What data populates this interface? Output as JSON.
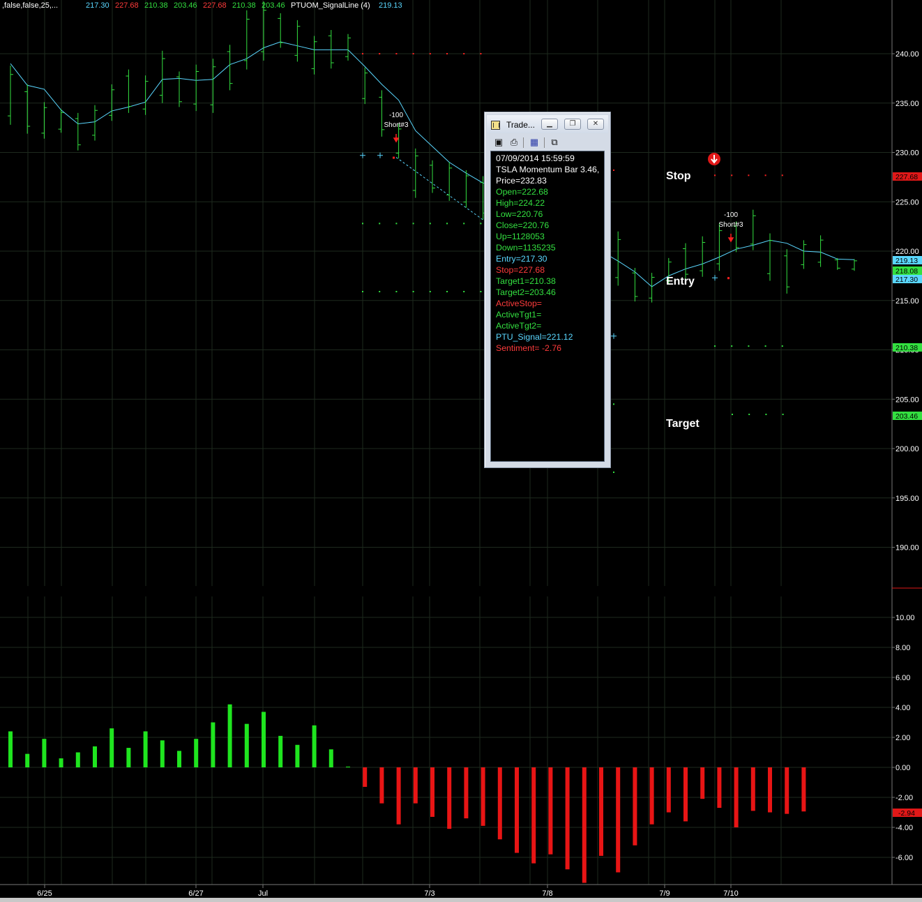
{
  "header": {
    "segments": [
      {
        "text": ",false,false,25,...",
        "color": "#ffffff"
      },
      {
        "text": "217.30",
        "color": "#5ad7ff"
      },
      {
        "text": "227.68",
        "color": "#ff3b3b"
      },
      {
        "text": "210.38",
        "color": "#33e040"
      },
      {
        "text": "203.46",
        "color": "#33e040"
      },
      {
        "text": "227.68",
        "color": "#ff3b3b"
      },
      {
        "text": "210.38",
        "color": "#33e040"
      },
      {
        "text": "203.46",
        "color": "#33e040"
      },
      {
        "text": "PTUOM_SignalLine (4)",
        "color": "#ffffff"
      },
      {
        "text": "219.13",
        "color": "#5ad7ff"
      }
    ]
  },
  "colors": {
    "background": "#000000",
    "bar": "#33e040",
    "signal_line": "#5ad7ff",
    "stop": "#ff2020",
    "target": "#33e040",
    "hist_pos": "#1fe51f",
    "hist_neg": "#e81515",
    "grid": "#1e2a1e",
    "axis_text": "#ffffff"
  },
  "chart_data": [
    {
      "type": "ohlc",
      "name": "price-panel",
      "symbol": "TSLA",
      "ylim": [
        186,
        245
      ],
      "y_ticks": [
        "240.00",
        "235.00",
        "230.00",
        "225.00",
        "220.00",
        "215.00",
        "210.00",
        "205.00",
        "200.00",
        "195.00",
        "190.00"
      ],
      "x_tick_labels": [
        "6/25",
        "6/27",
        "Jul",
        "7/3",
        "7/8",
        "7/9",
        "7/10"
      ],
      "bars": [
        {
          "h": 238.8,
          "l": 232.8
        },
        {
          "h": 236.9,
          "l": 231.9
        },
        {
          "h": 235.1,
          "l": 231.4
        },
        {
          "h": 234.4,
          "l": 232.0
        },
        {
          "h": 234.0,
          "l": 230.2
        },
        {
          "h": 234.8,
          "l": 231.2
        },
        {
          "h": 236.9,
          "l": 233.2
        },
        {
          "h": 238.4,
          "l": 234.0
        },
        {
          "h": 237.8,
          "l": 233.8
        },
        {
          "h": 240.3,
          "l": 235.0
        },
        {
          "h": 238.2,
          "l": 234.6
        },
        {
          "h": 238.9,
          "l": 234.2
        },
        {
          "h": 239.5,
          "l": 234.0
        },
        {
          "h": 240.9,
          "l": 236.3
        },
        {
          "h": 244.4,
          "l": 238.4
        },
        {
          "h": 245.3,
          "l": 239.3
        },
        {
          "h": 244.1,
          "l": 240.6
        },
        {
          "h": 243.4,
          "l": 239.2
        },
        {
          "h": 241.8,
          "l": 237.9
        },
        {
          "h": 242.4,
          "l": 238.5
        },
        {
          "h": 242.0,
          "l": 239.3
        },
        {
          "h": 238.6,
          "l": 234.9
        },
        {
          "h": 236.3,
          "l": 231.6
        },
        {
          "h": 232.9,
          "l": 229.4
        },
        {
          "h": 230.4,
          "l": 225.4
        },
        {
          "h": 229.2,
          "l": 225.9
        },
        {
          "h": 229.0,
          "l": 225.1
        },
        {
          "h": 228.2,
          "l": 224.4
        },
        {
          "h": 227.6,
          "l": 223.2
        },
        {
          "h": 228.0,
          "l": 224.0
        },
        {
          "h": 226.5,
          "l": 222.0
        },
        {
          "h": 225.0,
          "l": 220.0
        },
        {
          "h": 224.5,
          "l": 219.5
        },
        {
          "h": 224.0,
          "l": 220.1
        },
        {
          "h": 223.5,
          "l": 218.5
        },
        {
          "h": 223.0,
          "l": 218.0
        },
        {
          "h": 222.0,
          "l": 216.5
        },
        {
          "h": 218.3,
          "l": 214.9
        },
        {
          "h": 217.8,
          "l": 214.8
        },
        {
          "h": 219.3,
          "l": 216.6
        },
        {
          "h": 220.8,
          "l": 217.1
        },
        {
          "h": 221.5,
          "l": 217.4
        },
        {
          "h": 222.8,
          "l": 218.0
        },
        {
          "h": 223.0,
          "l": 219.9
        },
        {
          "h": 224.2,
          "l": 220.1
        },
        {
          "h": 221.8,
          "l": 217.0
        },
        {
          "h": 220.2,
          "l": 215.7
        },
        {
          "h": 221.1,
          "l": 218.2
        },
        {
          "h": 221.6,
          "l": 218.4
        },
        {
          "h": 219.3,
          "l": 218.1
        },
        {
          "h": 219.2,
          "l": 218.0
        }
      ],
      "signal_line": [
        239.0,
        236.8,
        236.4,
        234.3,
        232.9,
        233.1,
        234.2,
        234.6,
        235.1,
        237.4,
        237.5,
        237.3,
        237.4,
        238.9,
        239.5,
        240.6,
        241.2,
        240.8,
        240.4,
        240.4,
        240.4,
        238.7,
        236.9,
        235.3,
        232.2,
        230.6,
        229.0,
        227.9,
        226.9,
        226.7,
        225.5,
        224.3,
        223.2,
        222.3,
        221.2,
        220.0,
        219.0,
        217.9,
        216.4,
        217.5,
        218.2,
        218.7,
        219.4,
        220.2,
        220.6,
        221.1,
        220.8,
        220.0,
        219.9,
        219.2,
        219.13
      ],
      "price_markers": [
        {
          "value": "227.68",
          "bg": "#e01818",
          "fg": "#000000"
        },
        {
          "value": "219.13",
          "bg": "#5ad7ff",
          "fg": "#000000"
        },
        {
          "value": "218.08",
          "bg": "#33e040",
          "fg": "#000000"
        },
        {
          "value": "217.30",
          "bg": "#5ad7ff",
          "fg": "#000000"
        },
        {
          "value": "210.38",
          "bg": "#33e040",
          "fg": "#000000"
        },
        {
          "value": "203.46",
          "bg": "#33e040",
          "fg": "#000000"
        }
      ],
      "annotations": {
        "stop_label": "Stop",
        "entry_label": "Entry",
        "target_label": "Target",
        "short1_qty": "-100",
        "short1_name": "Short#3",
        "short2_qty": "-100",
        "short2_name": "Short#3"
      },
      "levels": {
        "old_stop": 240.0,
        "old_entry": 229.7,
        "old_target1": 222.8,
        "old_target2": 215.9,
        "stop": 227.68,
        "entry": 217.3,
        "target1": 210.38,
        "target2": 203.46
      }
    },
    {
      "type": "bar",
      "name": "momentum-histogram",
      "ylim": [
        -7.8,
        10.8
      ],
      "y_ticks": [
        "10.00",
        "8.00",
        "6.00",
        "4.00",
        "2.00",
        "0.00",
        "-2.00",
        "-4.00",
        "-6.00"
      ],
      "last_value": "-2.94",
      "values": [
        2.4,
        0.9,
        1.9,
        0.6,
        1.0,
        1.4,
        2.6,
        1.3,
        2.4,
        1.8,
        1.1,
        1.9,
        3.0,
        4.2,
        2.9,
        3.7,
        2.1,
        1.5,
        2.8,
        1.2,
        0.05,
        -1.3,
        -2.4,
        -3.8,
        -2.4,
        -3.3,
        -4.1,
        -3.4,
        -3.9,
        -4.8,
        -5.7,
        -6.4,
        -5.8,
        -6.8,
        -7.7,
        -5.9,
        -7.0,
        -5.2,
        -3.8,
        -3.0,
        -3.6,
        -2.1,
        -2.7,
        -4.0,
        -2.9,
        -3.0,
        -3.1,
        -2.94
      ]
    }
  ],
  "popup": {
    "title": "Trade...",
    "rows": [
      {
        "text": "07/09/2014 15:59:59",
        "color": "#ffffff"
      },
      {
        "text": "TSLA Momentum Bar 3.46,",
        "color": "#ffffff"
      },
      {
        "text": "Price=232.83",
        "color": "#ffffff"
      },
      {
        "text": "Open=222.68",
        "color": "#33e040"
      },
      {
        "text": "High=224.22",
        "color": "#33e040"
      },
      {
        "text": "Low=220.76",
        "color": "#33e040"
      },
      {
        "text": "Close=220.76",
        "color": "#33e040"
      },
      {
        "text": "Up=1128053",
        "color": "#33e040"
      },
      {
        "text": "Down=1135235",
        "color": "#33e040"
      },
      {
        "text": "Entry=217.30",
        "color": "#5ad7ff"
      },
      {
        "text": "Stop=227.68",
        "color": "#ff3b3b"
      },
      {
        "text": "Target1=210.38",
        "color": "#33e040"
      },
      {
        "text": "Target2=203.46",
        "color": "#33e040"
      },
      {
        "text": "ActiveStop=",
        "color": "#ff3b3b"
      },
      {
        "text": "ActiveTgt1=",
        "color": "#33e040"
      },
      {
        "text": "ActiveTgt2=",
        "color": "#33e040"
      },
      {
        "text": "PTU_Signal=221.12",
        "color": "#5ad7ff"
      },
      {
        "text": "Sentiment= -2.76",
        "color": "#ff3b3b"
      }
    ]
  }
}
